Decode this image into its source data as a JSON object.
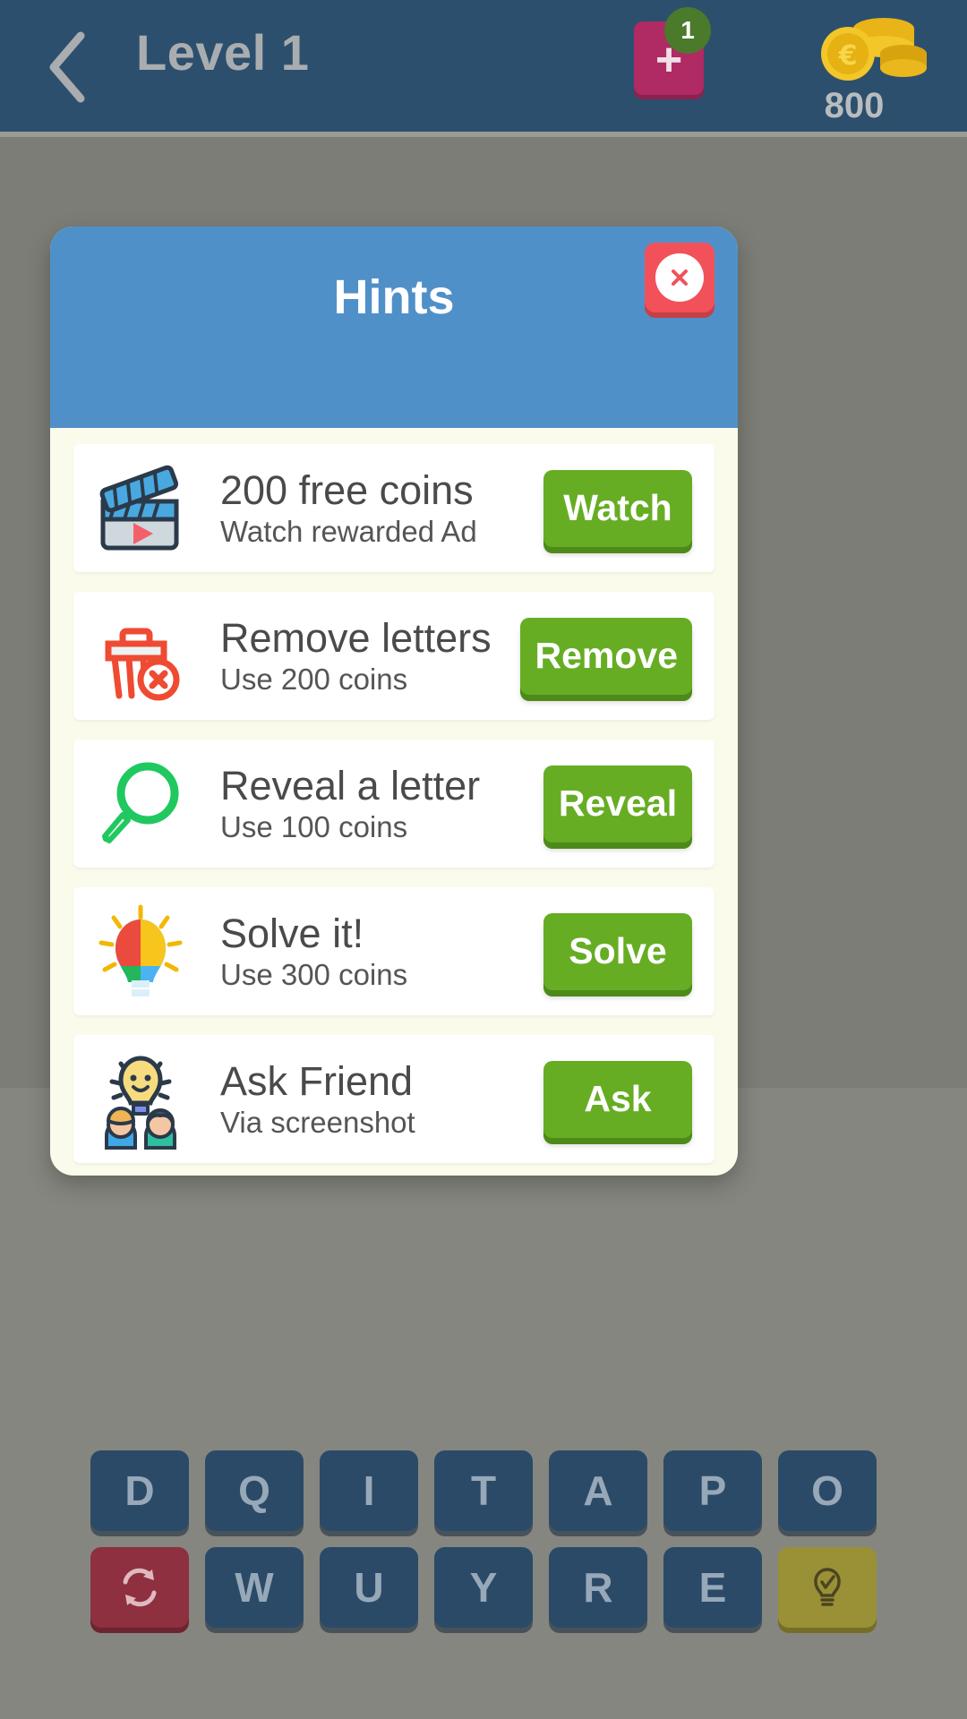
{
  "header": {
    "back_icon": "chevron-left-icon",
    "title": "Level 1",
    "plus_icon": "plus-icon",
    "plus_badge": "1",
    "coin_icon": "coin-stack-icon",
    "coin_count": "800"
  },
  "dialog": {
    "title": "Hints",
    "close_icon": "close-x-icon",
    "items": [
      {
        "icon": "clapperboard-video-icon",
        "title": "200 free coins",
        "subtitle": "Watch rewarded Ad",
        "action_label": "Watch"
      },
      {
        "icon": "trash-delete-icon",
        "title": "Remove letters",
        "subtitle": "Use 200 coins",
        "action_label": "Remove"
      },
      {
        "icon": "magnifier-search-icon",
        "title": "Reveal a letter",
        "subtitle": "Use 100 coins",
        "action_label": "Reveal"
      },
      {
        "icon": "puzzle-lightbulb-icon",
        "title": "Solve it!",
        "subtitle": "Use 300 coins",
        "action_label": "Solve"
      },
      {
        "icon": "friends-idea-icon",
        "title": "Ask Friend",
        "subtitle": "Via screenshot",
        "action_label": "Ask"
      }
    ]
  },
  "keyboard": {
    "row1": [
      "D",
      "Q",
      "I",
      "T",
      "A",
      "P",
      "O"
    ],
    "row2_shuffle_icon": "shuffle-refresh-icon",
    "row2": [
      "W",
      "U",
      "Y",
      "R",
      "E"
    ],
    "row2_hint_icon": "lightbulb-hint-icon"
  },
  "colors": {
    "header_bg": "#2d4f6e",
    "dialog_header": "#5090c9",
    "dialog_bg": "#fbfbec",
    "action_green": "#66ad24",
    "close_red": "#f2515a",
    "plus_magenta": "#b02a63",
    "badge_green": "#4b7a2a",
    "backdrop": "#7c7d76",
    "key_blue": "#2b4a68",
    "key_shuffle_red": "#8e3040",
    "key_hint_yellow": "#9a9036"
  }
}
